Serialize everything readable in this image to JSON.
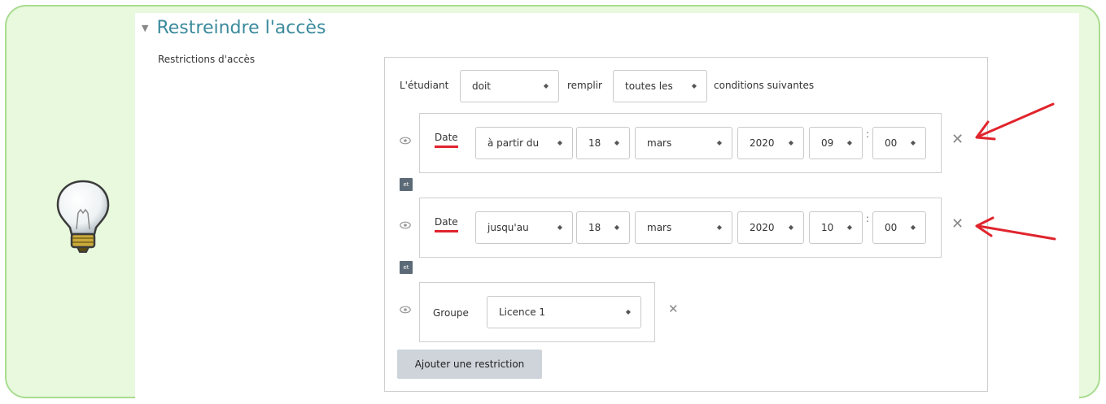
{
  "section": {
    "title": "Restreindre l'accès",
    "field_label": "Restrictions d'accès"
  },
  "header_row": {
    "prefix": "L'étudiant",
    "must_value": "doit",
    "middle": "remplir",
    "scope_value": "toutes les",
    "suffix": "conditions suivantes"
  },
  "conditions": [
    {
      "label": "Date",
      "direction": "à partir du",
      "day": "18",
      "month": "mars",
      "year": "2020",
      "hour": "09",
      "minute": "00"
    },
    {
      "label": "Date",
      "direction": "jusqu'au",
      "day": "18",
      "month": "mars",
      "year": "2020",
      "hour": "10",
      "minute": "00"
    }
  ],
  "group_condition": {
    "label": "Groupe",
    "value": "Licence 1"
  },
  "connector": "et",
  "time_separator": ":",
  "add_button": "Ajouter une restriction",
  "colors": {
    "callout_bg": "#e8f9de",
    "callout_border": "#a9dc8f",
    "title": "#3b8a9c",
    "annotation": "#e0242d"
  }
}
